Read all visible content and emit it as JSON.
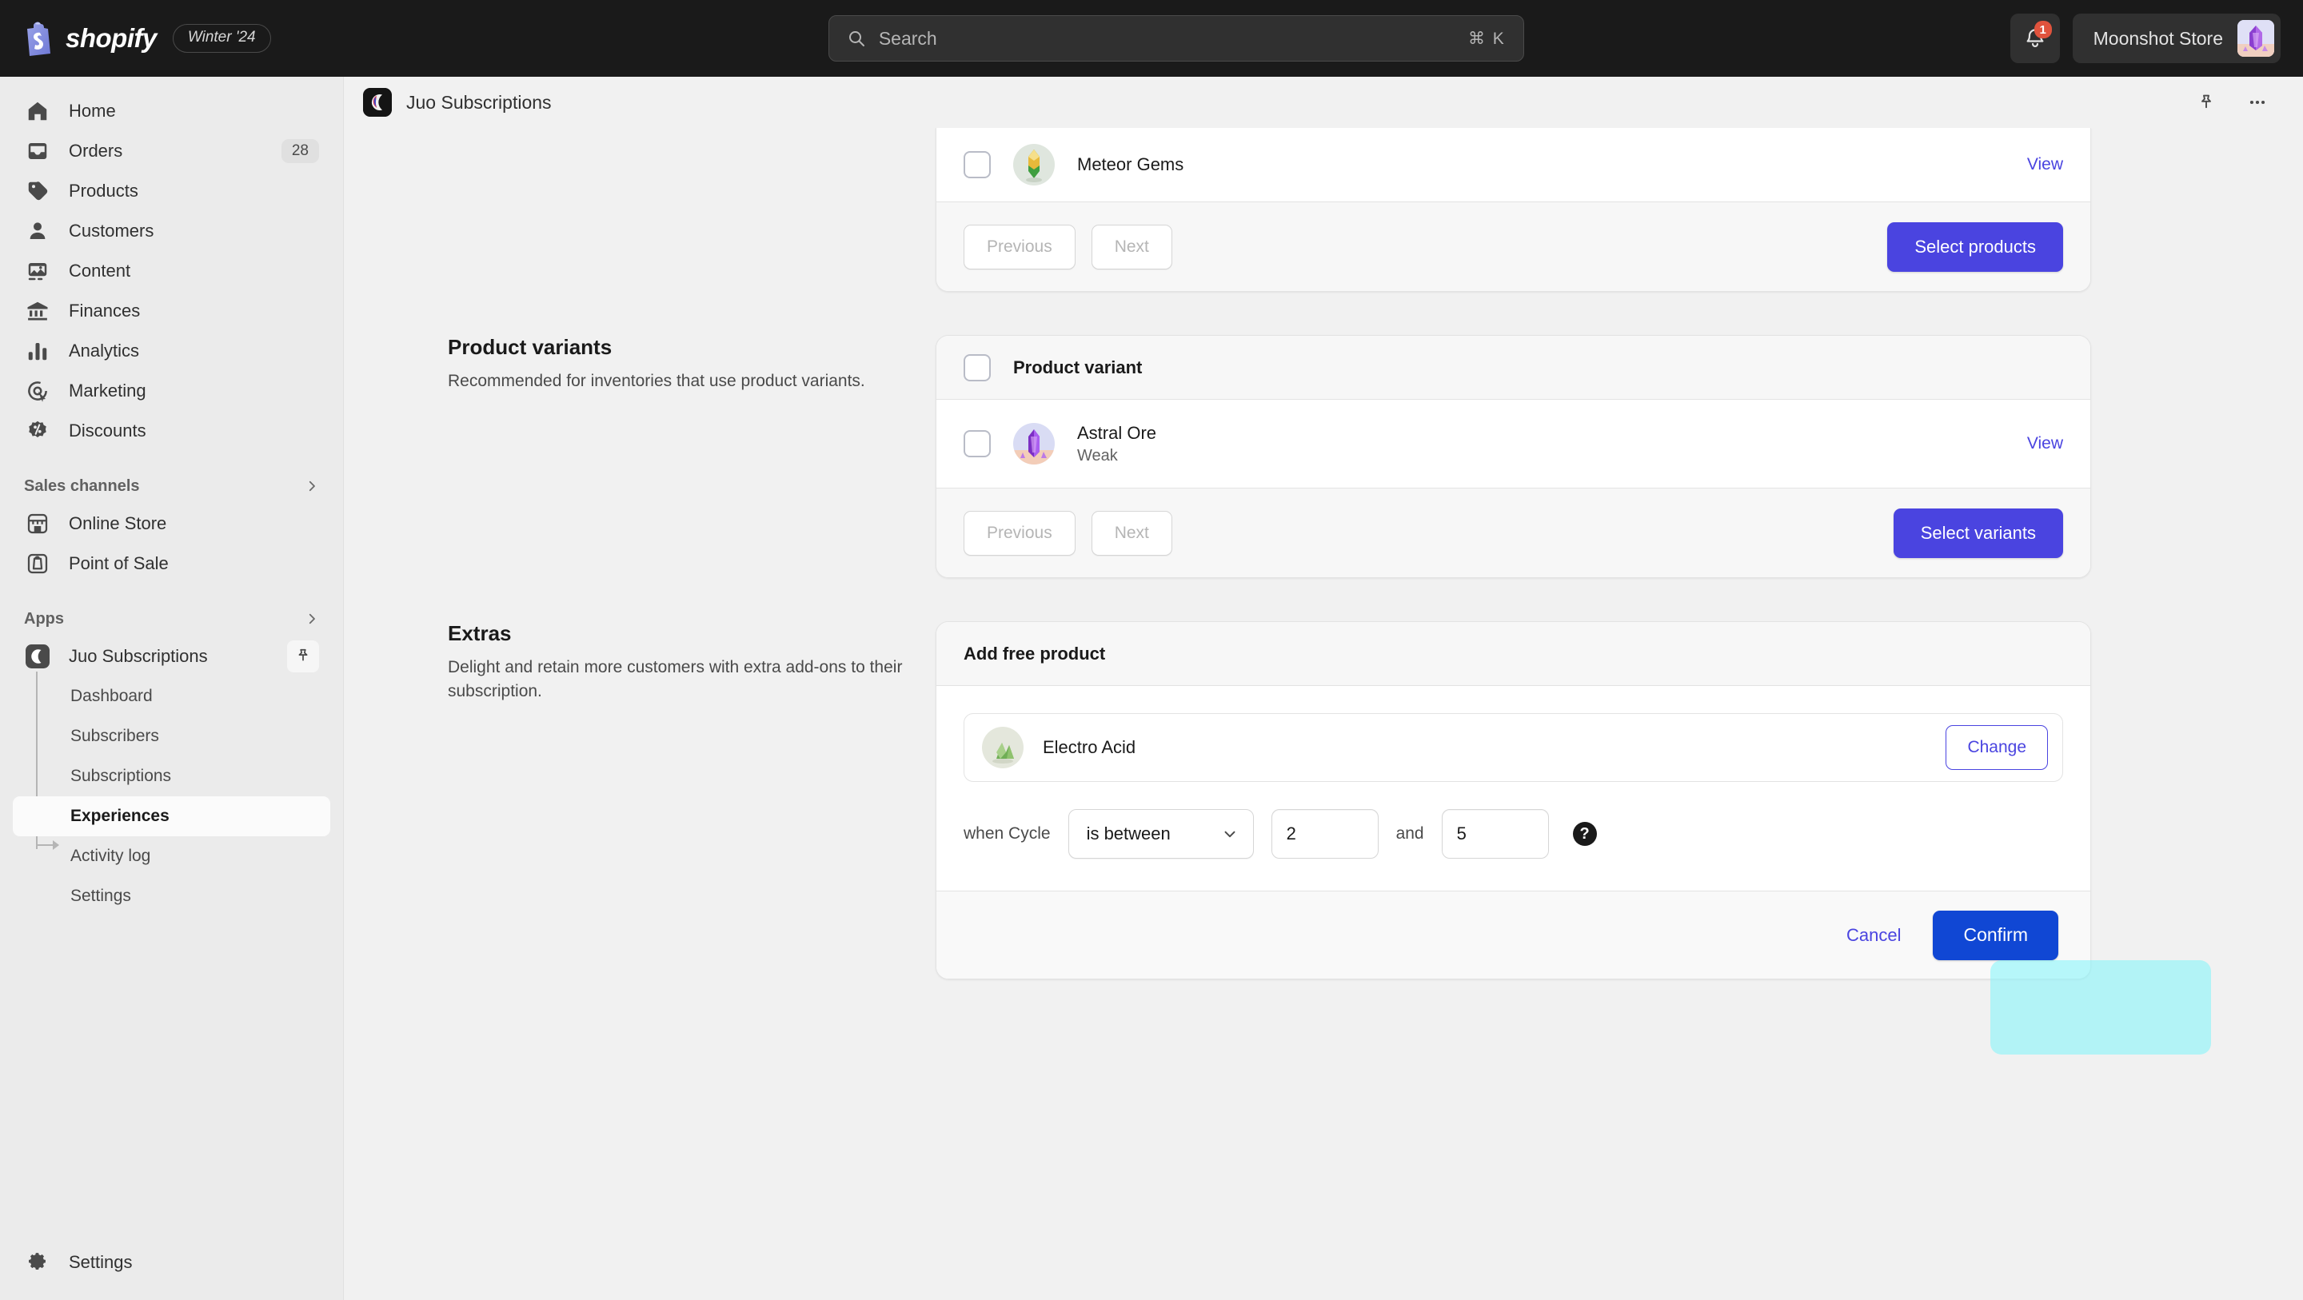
{
  "topbar": {
    "brand": "shopify",
    "season_badge": "Winter '24",
    "search": {
      "placeholder": "Search",
      "shortcut": "⌘ K"
    },
    "notifications_count": "1",
    "store_name": "Moonshot Store"
  },
  "sidebar": {
    "items": [
      {
        "label": "Home",
        "icon": "home-icon",
        "count": ""
      },
      {
        "label": "Orders",
        "icon": "orders-icon",
        "count": "28"
      },
      {
        "label": "Products",
        "icon": "products-tag-icon",
        "count": ""
      },
      {
        "label": "Customers",
        "icon": "customers-person-icon",
        "count": ""
      },
      {
        "label": "Content",
        "icon": "content-image-icon",
        "count": ""
      },
      {
        "label": "Finances",
        "icon": "finances-bank-icon",
        "count": ""
      },
      {
        "label": "Analytics",
        "icon": "analytics-bars-icon",
        "count": ""
      },
      {
        "label": "Marketing",
        "icon": "marketing-target-icon",
        "count": ""
      },
      {
        "label": "Discounts",
        "icon": "discounts-badge-icon",
        "count": ""
      }
    ],
    "sales_channels": {
      "label": "Sales channels",
      "items": [
        {
          "label": "Online Store",
          "icon": "online-store-icon"
        },
        {
          "label": "Point of Sale",
          "icon": "point-of-sale-icon"
        }
      ]
    },
    "apps": {
      "label": "Apps",
      "app_name": "Juo Subscriptions",
      "sub_items": [
        {
          "label": "Dashboard",
          "active": false
        },
        {
          "label": "Subscribers",
          "active": false
        },
        {
          "label": "Subscriptions",
          "active": false
        },
        {
          "label": "Experiences",
          "active": true
        },
        {
          "label": "Activity log",
          "active": false
        },
        {
          "label": "Settings",
          "active": false
        }
      ]
    },
    "bottom": {
      "label": "Settings",
      "icon": "gear-icon"
    }
  },
  "app_header": {
    "title": "Juo Subscriptions",
    "pin_icon": "pin-icon",
    "more_icon": "more-horizontal-icon"
  },
  "products_card": {
    "row": {
      "name": "Meteor Gems",
      "view_label": "View"
    },
    "previous_label": "Previous",
    "next_label": "Next",
    "select_label": "Select products"
  },
  "variants_section": {
    "heading": "Product variants",
    "description": "Recommended for inventories that use product variants.",
    "card_header": "Product variant",
    "row": {
      "name": "Astral Ore",
      "subtitle": "Weak",
      "view_label": "View"
    },
    "previous_label": "Previous",
    "next_label": "Next",
    "select_label": "Select variants"
  },
  "extras_section": {
    "heading": "Extras",
    "description": "Delight and retain more customers with extra add-ons to their subscription.",
    "card_header": "Add free product",
    "product": {
      "name": "Electro Acid",
      "change_label": "Change"
    },
    "condition": {
      "prefix": "when Cycle",
      "operator": "is between",
      "value_from": "2",
      "conjunction": "and",
      "value_to": "5",
      "help_icon": "help-question-icon"
    },
    "cancel_label": "Cancel",
    "confirm_label": "Confirm"
  },
  "colors": {
    "accent_indigo": "#4a44e0",
    "confirm_blue": "#1047d4",
    "highlight_cyan": "#78f5fc",
    "topbar_dark": "#1a1a1a",
    "sidebar_bg": "#ebebeb"
  }
}
